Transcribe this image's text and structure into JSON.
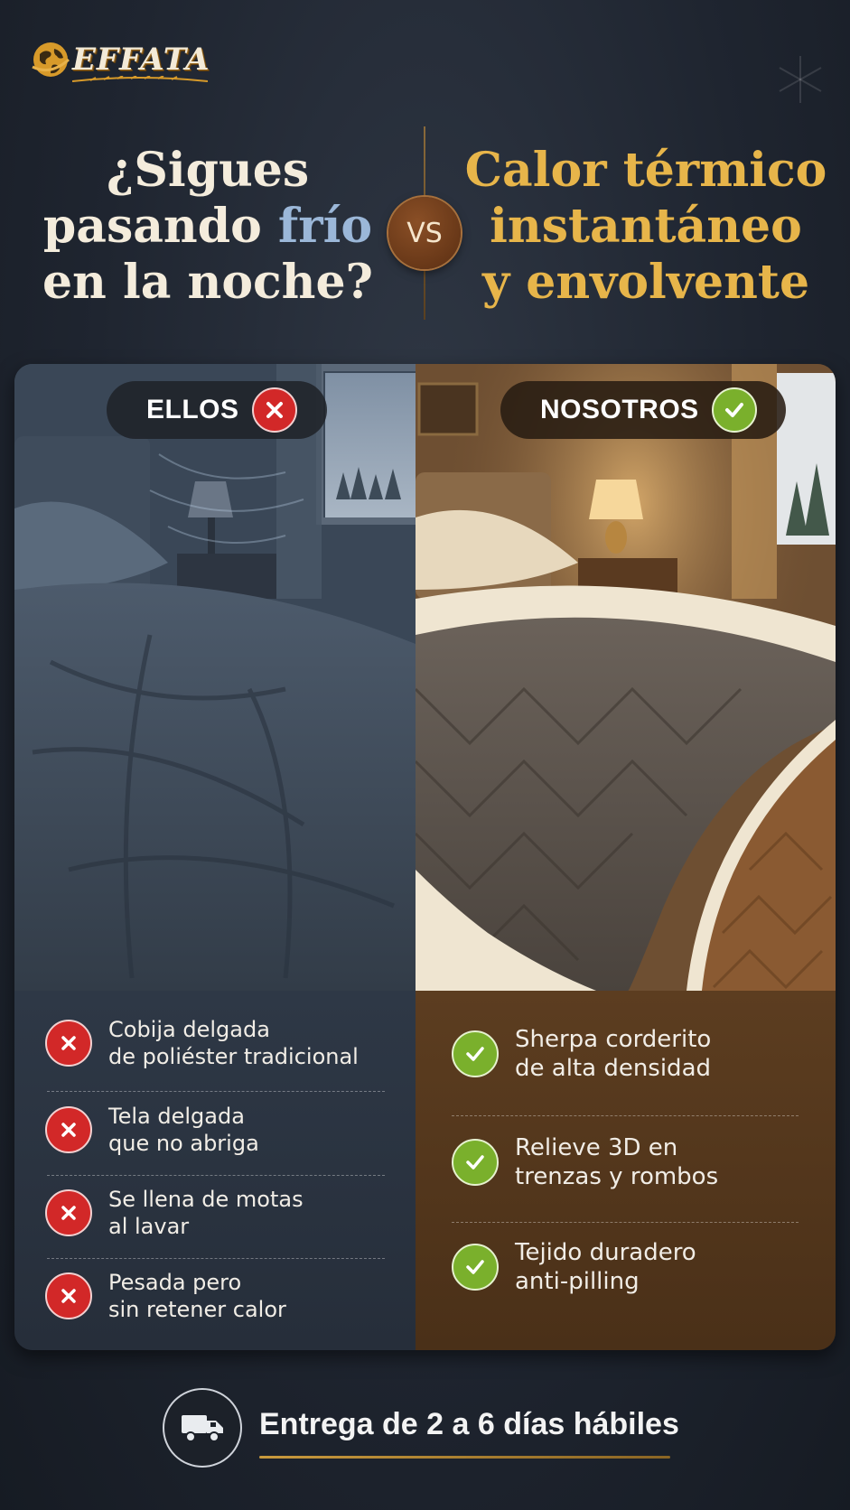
{
  "brand": {
    "logo_text": "EFFATA"
  },
  "headline": {
    "left_line1": "¿Sigues",
    "left_line2_a": "pasando ",
    "left_line2_accent": "frío",
    "left_line3": "en la noche?",
    "vs": "VS",
    "right_line1": "Calor térmico",
    "right_line2": "instantáneo",
    "right_line3": "y envolvente"
  },
  "colors": {
    "accent_gold": "#e7b54a",
    "accent_blue": "#9bb7d8",
    "bad_red": "#d22828",
    "good_green": "#7ab02c"
  },
  "comparison": {
    "left": {
      "label": "ELLOS",
      "badge_icon": "x-icon",
      "items": [
        {
          "line1": "Cobija delgada",
          "line2": "de poliéster tradicional"
        },
        {
          "line1": "Tela delgada",
          "line2": "que no abriga"
        },
        {
          "line1": "Se llena de motas",
          "line2": "al lavar"
        },
        {
          "line1": "Pesada pero",
          "line2": "sin retener calor"
        }
      ]
    },
    "right": {
      "label": "NOSOTROS",
      "badge_icon": "check-icon",
      "items": [
        {
          "line1": "Sherpa corderito",
          "line2": "de alta densidad"
        },
        {
          "line1": "Relieve 3D en",
          "line2": "trenzas y rombos"
        },
        {
          "line1": "Tejido duradero",
          "line2": "anti-pilling"
        }
      ]
    }
  },
  "footer": {
    "delivery_text": "Entrega de 2 a 6 días hábiles",
    "icon": "truck-icon"
  }
}
